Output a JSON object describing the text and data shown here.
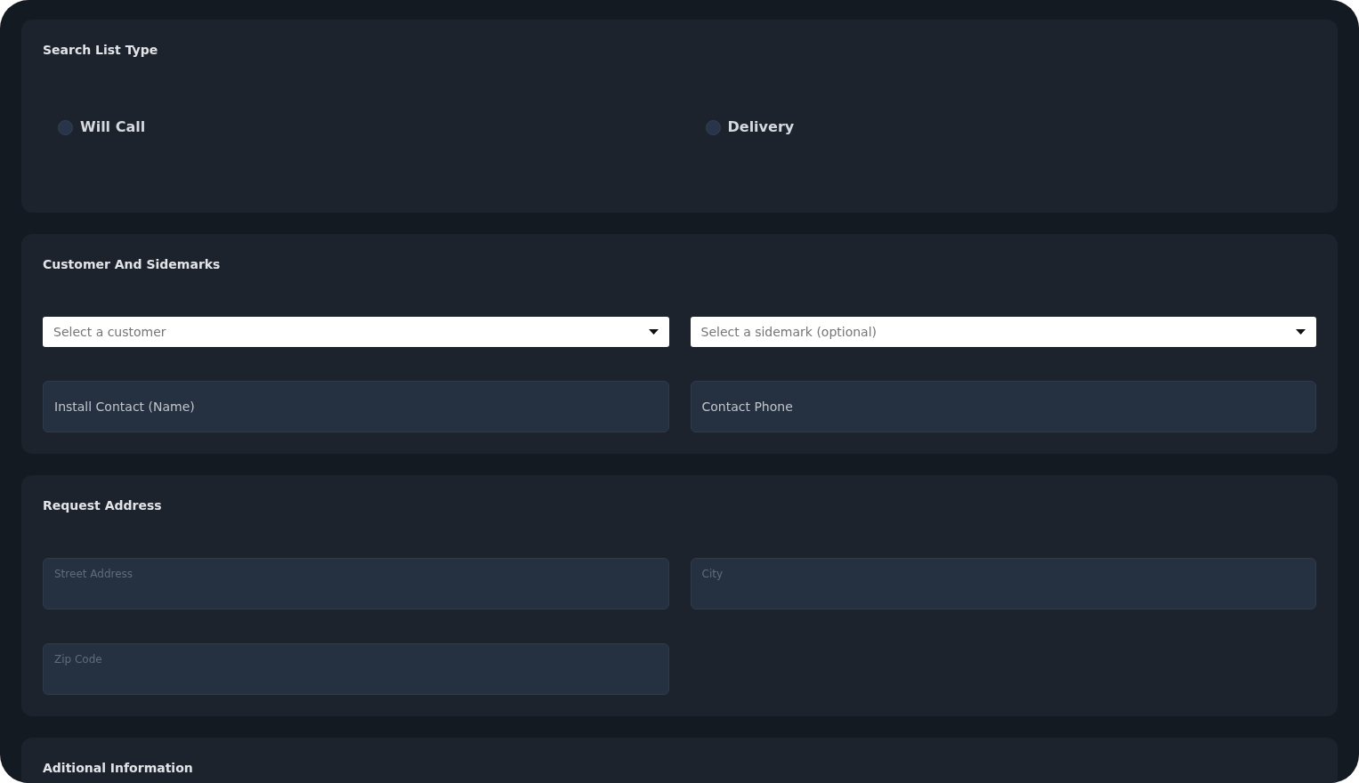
{
  "sections": [
    {
      "kind": "radios",
      "title": "Search List Type",
      "options": [
        {
          "label": "Will Call",
          "selected": false
        },
        {
          "label": "Delivery",
          "selected": false
        }
      ]
    },
    {
      "kind": "fields",
      "title": "Customer And Sidemarks",
      "fields": [
        {
          "kind": "select",
          "placeholder": "Select a customer"
        },
        {
          "kind": "select",
          "placeholder": "Select a sidemark (optional)"
        },
        {
          "kind": "text",
          "placeholder": "Install Contact (Name)"
        },
        {
          "kind": "text",
          "placeholder": "Contact Phone"
        }
      ]
    },
    {
      "kind": "fields",
      "title": "Request Address",
      "fields": [
        {
          "kind": "area",
          "placeholder": "Street Address"
        },
        {
          "kind": "area",
          "placeholder": "City"
        },
        {
          "kind": "area",
          "placeholder": "Zip Code"
        }
      ]
    },
    {
      "kind": "fields",
      "title": "Aditional Information"
    }
  ]
}
